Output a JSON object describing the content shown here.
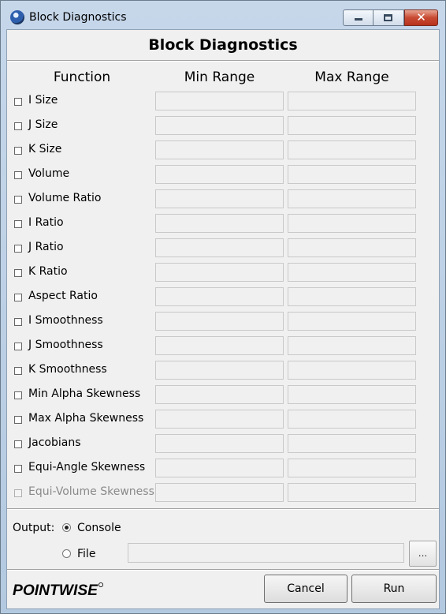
{
  "window": {
    "title": "Block Diagnostics"
  },
  "dialog": {
    "heading": "Block Diagnostics",
    "columns": {
      "function": "Function",
      "min_range": "Min Range",
      "max_range": "Max Range"
    },
    "rows": [
      {
        "label": "I Size",
        "checked": false,
        "enabled": true,
        "min": "",
        "max": ""
      },
      {
        "label": "J Size",
        "checked": false,
        "enabled": true,
        "min": "",
        "max": ""
      },
      {
        "label": "K Size",
        "checked": false,
        "enabled": true,
        "min": "",
        "max": ""
      },
      {
        "label": "Volume",
        "checked": false,
        "enabled": true,
        "min": "",
        "max": ""
      },
      {
        "label": "Volume Ratio",
        "checked": false,
        "enabled": true,
        "min": "",
        "max": ""
      },
      {
        "label": "I Ratio",
        "checked": false,
        "enabled": true,
        "min": "",
        "max": ""
      },
      {
        "label": "J Ratio",
        "checked": false,
        "enabled": true,
        "min": "",
        "max": ""
      },
      {
        "label": "K Ratio",
        "checked": false,
        "enabled": true,
        "min": "",
        "max": ""
      },
      {
        "label": "Aspect Ratio",
        "checked": false,
        "enabled": true,
        "min": "",
        "max": ""
      },
      {
        "label": "I Smoothness",
        "checked": false,
        "enabled": true,
        "min": "",
        "max": ""
      },
      {
        "label": "J Smoothness",
        "checked": false,
        "enabled": true,
        "min": "",
        "max": ""
      },
      {
        "label": "K Smoothness",
        "checked": false,
        "enabled": true,
        "min": "",
        "max": ""
      },
      {
        "label": "Min Alpha Skewness",
        "checked": false,
        "enabled": true,
        "min": "",
        "max": ""
      },
      {
        "label": "Max Alpha Skewness",
        "checked": false,
        "enabled": true,
        "min": "",
        "max": ""
      },
      {
        "label": "Jacobians",
        "checked": false,
        "enabled": true,
        "min": "",
        "max": ""
      },
      {
        "label": "Equi-Angle Skewness",
        "checked": false,
        "enabled": true,
        "min": "",
        "max": ""
      },
      {
        "label": "Equi-Volume Skewness",
        "checked": false,
        "enabled": false,
        "min": "",
        "max": ""
      }
    ],
    "output": {
      "label": "Output:",
      "options": [
        {
          "label": "Console",
          "selected": true
        },
        {
          "label": "File",
          "selected": false
        }
      ],
      "file_path": "",
      "browse_label": "..."
    },
    "logo_text": "POINTWISE",
    "buttons": {
      "cancel": "Cancel",
      "run": "Run"
    }
  }
}
